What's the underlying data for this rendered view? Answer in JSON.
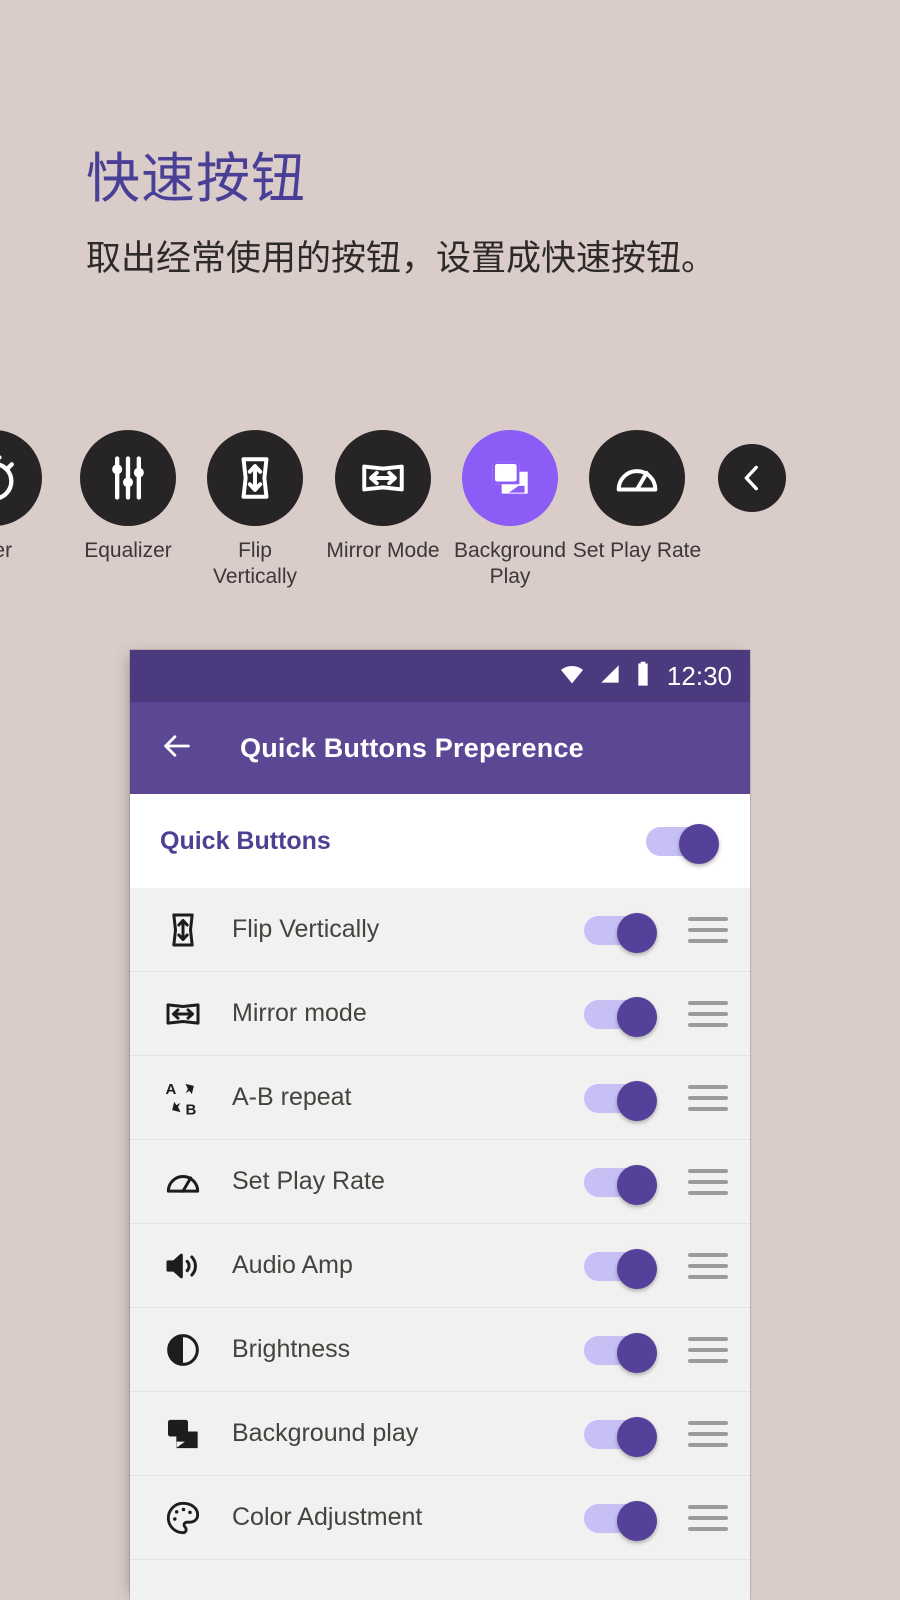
{
  "promo": {
    "headline": "快速按钮",
    "subhead": "取出经常使用的按钮，设置成快速按钮。"
  },
  "colors": {
    "background": "#d9ccc9",
    "headline_purple": "#4a3f96",
    "appbar_purple": "#5c4795",
    "statusbar_purple": "#4b3a7e",
    "accent_violet": "#8b5cf6",
    "toggle_thumb": "#55409a",
    "toggle_track": "#c7c0f4",
    "circle_dark": "#272425"
  },
  "carousel": {
    "items": [
      {
        "label": "mer",
        "icon": "timer-icon",
        "active": false,
        "kind": "partial"
      },
      {
        "label": "Equalizer",
        "icon": "equalizer-icon",
        "active": false,
        "kind": "full"
      },
      {
        "label": "Flip\nVertically",
        "icon": "flip-vertically-icon",
        "active": false,
        "kind": "full"
      },
      {
        "label": "Mirror Mode",
        "icon": "mirror-mode-icon",
        "active": false,
        "kind": "full"
      },
      {
        "label": "Background\nPlay",
        "icon": "background-play-icon",
        "active": true,
        "kind": "full"
      },
      {
        "label": "Set Play Rate",
        "icon": "set-play-rate-icon",
        "active": false,
        "kind": "full"
      },
      {
        "label": "",
        "icon": "chevron-left-icon",
        "active": false,
        "kind": "nav"
      }
    ]
  },
  "phone": {
    "statusbar": {
      "clock": "12:30",
      "icons": [
        "wifi-icon",
        "signal-icon",
        "battery-icon"
      ]
    },
    "appbar": {
      "back_icon": "back-arrow-icon",
      "title": "Quick Buttons Preperence"
    },
    "master_row": {
      "label": "Quick Buttons",
      "enabled": true
    },
    "list": [
      {
        "label": "Flip Vertically",
        "icon": "flip-vertically-icon",
        "enabled": true
      },
      {
        "label": "Mirror mode",
        "icon": "mirror-mode-icon",
        "enabled": true
      },
      {
        "label": "A-B repeat",
        "icon": "ab-repeat-icon",
        "enabled": true
      },
      {
        "label": "Set Play Rate",
        "icon": "set-play-rate-icon",
        "enabled": true
      },
      {
        "label": "Audio Amp",
        "icon": "audio-amp-icon",
        "enabled": true
      },
      {
        "label": "Brightness",
        "icon": "brightness-icon",
        "enabled": true
      },
      {
        "label": "Background play",
        "icon": "background-play-icon",
        "enabled": true
      },
      {
        "label": "Color Adjustment",
        "icon": "color-adjustment-icon",
        "enabled": true
      }
    ]
  }
}
